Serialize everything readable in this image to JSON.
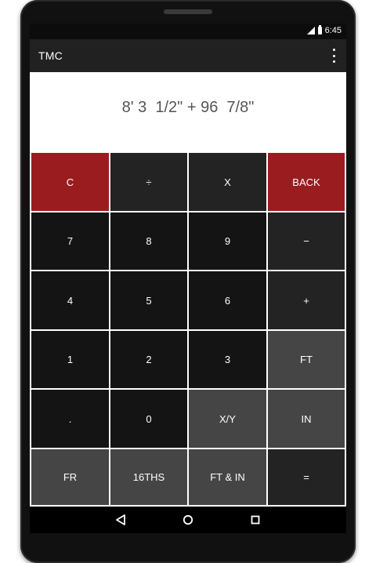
{
  "status_bar": {
    "time": "6:45"
  },
  "app": {
    "title": "TMC"
  },
  "display": {
    "expression": "8' 3  1/2\" + 96  7/8\""
  },
  "keys": [
    {
      "label": "C",
      "style": "red",
      "name": "clear-key"
    },
    {
      "label": "÷",
      "style": "dark",
      "name": "divide-key"
    },
    {
      "label": "X",
      "style": "dark",
      "name": "multiply-key"
    },
    {
      "label": "BACK",
      "style": "red",
      "name": "back-key"
    },
    {
      "label": "7",
      "style": "black",
      "name": "digit-7-key"
    },
    {
      "label": "8",
      "style": "black",
      "name": "digit-8-key"
    },
    {
      "label": "9",
      "style": "black",
      "name": "digit-9-key"
    },
    {
      "label": "−",
      "style": "dark",
      "name": "subtract-key"
    },
    {
      "label": "4",
      "style": "black",
      "name": "digit-4-key"
    },
    {
      "label": "5",
      "style": "black",
      "name": "digit-5-key"
    },
    {
      "label": "6",
      "style": "black",
      "name": "digit-6-key"
    },
    {
      "label": "+",
      "style": "dark",
      "name": "add-key"
    },
    {
      "label": "1",
      "style": "black",
      "name": "digit-1-key"
    },
    {
      "label": "2",
      "style": "black",
      "name": "digit-2-key"
    },
    {
      "label": "3",
      "style": "black",
      "name": "digit-3-key"
    },
    {
      "label": "FT",
      "style": "grey",
      "name": "feet-key"
    },
    {
      "label": ".",
      "style": "black",
      "name": "decimal-key"
    },
    {
      "label": "0",
      "style": "black",
      "name": "digit-0-key"
    },
    {
      "label": "X/Y",
      "style": "grey",
      "name": "fraction-key"
    },
    {
      "label": "IN",
      "style": "grey",
      "name": "inches-key"
    },
    {
      "label": "FR",
      "style": "grey",
      "name": "fraction-mode-key"
    },
    {
      "label": "16THS",
      "style": "grey",
      "name": "sixteenths-key"
    },
    {
      "label": "FT & IN",
      "style": "grey",
      "name": "feet-inches-key"
    },
    {
      "label": "=",
      "style": "dark",
      "name": "equals-key"
    }
  ],
  "colors": {
    "red": "#9b1c1f",
    "dark": "#232323",
    "black": "#141414",
    "grey": "#454545"
  },
  "icons": {
    "signal": "signal-icon",
    "battery": "battery-icon",
    "overflow": "overflow-menu-icon",
    "nav_back": "nav-back-icon",
    "nav_home": "nav-home-icon",
    "nav_recent": "nav-recent-icon"
  }
}
